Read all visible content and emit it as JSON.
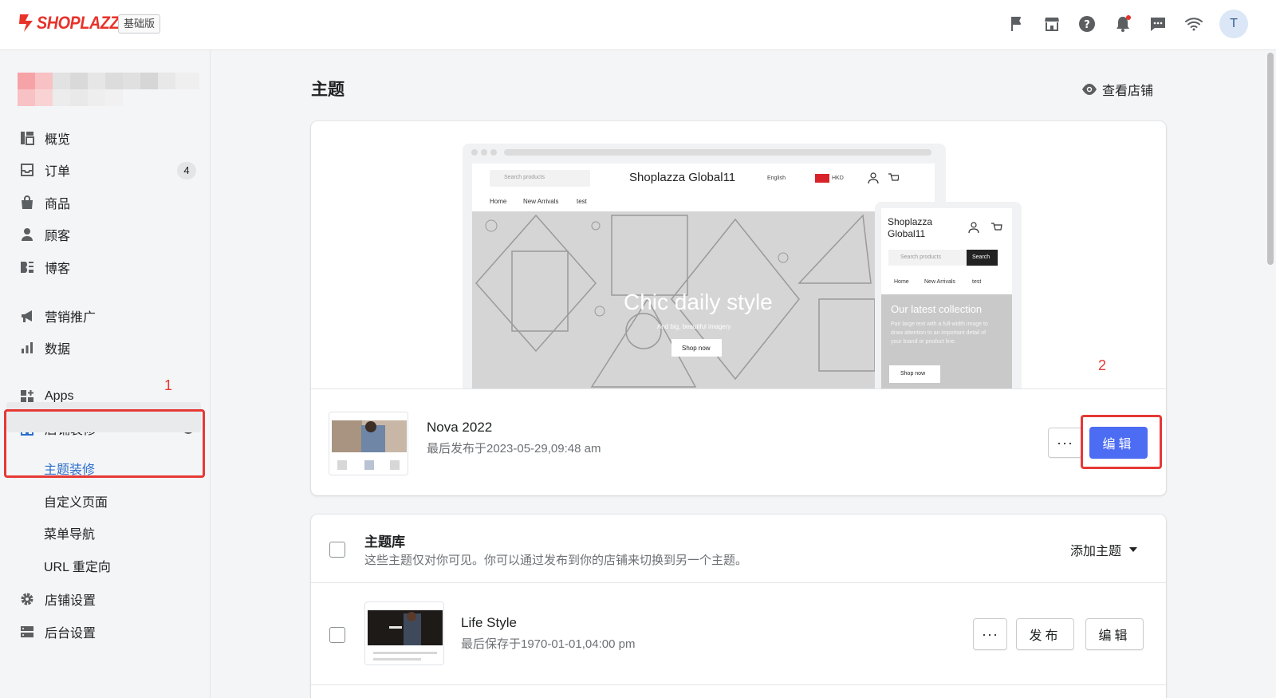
{
  "brand": {
    "name": "SHOPLAZZA",
    "plan": "基础版",
    "avatar_initial": "T"
  },
  "topbar_icons": [
    "flag-icon",
    "store-icon",
    "help-icon",
    "bell-icon",
    "chat-icon",
    "wifi-icon"
  ],
  "sidebar": {
    "items": [
      {
        "label": "概览",
        "icon": "dashboard-icon"
      },
      {
        "label": "订单",
        "icon": "inbox-icon",
        "badge": "4"
      },
      {
        "label": "商品",
        "icon": "bag-icon"
      },
      {
        "label": "顾客",
        "icon": "person-icon"
      },
      {
        "label": "博客",
        "icon": "blog-icon"
      },
      {
        "label": "营销推广",
        "icon": "megaphone-icon"
      },
      {
        "label": "数据",
        "icon": "bar-chart-icon"
      },
      {
        "label": "Apps",
        "icon": "apps-icon"
      },
      {
        "label": "店铺装修",
        "icon": "storefront-icon"
      },
      {
        "label": "店铺设置",
        "icon": "gear-icon"
      },
      {
        "label": "后台设置",
        "icon": "server-icon"
      }
    ],
    "sub_items": [
      "主题装修",
      "自定义页面",
      "菜单导航",
      "URL 重定向"
    ]
  },
  "annotations": {
    "one": "1",
    "two": "2"
  },
  "main": {
    "title": "主题",
    "view_store": "查看店铺",
    "current_theme": {
      "name": "Nova 2022",
      "meta": "最后发布于2023-05-29,09:48 am",
      "more": "···",
      "edit": "编辑"
    },
    "preview": {
      "store_name": "Shoplazza Global11",
      "search_placeholder": "Search products",
      "language": "English",
      "currency": "HKD",
      "nav": [
        "Home",
        "New Arrivals",
        "test"
      ],
      "hero_title": "Chic daily style",
      "hero_sub": "And big, beautiful imagery",
      "hero_button": "Shop now",
      "mobile_store_name_1": "Shoplazza",
      "mobile_store_name_2": "Global11",
      "mobile_search_button": "Search",
      "mobile_hero_title": "Our latest collection",
      "mobile_hero_text": "Pair large text with a full-width image to draw attention to an important detail of your brand or product line.",
      "mobile_hero_button": "Shop now"
    },
    "library": {
      "title": "主题库",
      "description": "这些主题仅对你可见。你可以通过发布到你的店铺来切换到另一个主题。",
      "add_theme": "添加主题",
      "themes": [
        {
          "name": "Life Style",
          "meta": "最后保存于1970-01-01,04:00 pm",
          "more": "···",
          "publish": "发布",
          "edit": "编辑"
        }
      ]
    }
  }
}
